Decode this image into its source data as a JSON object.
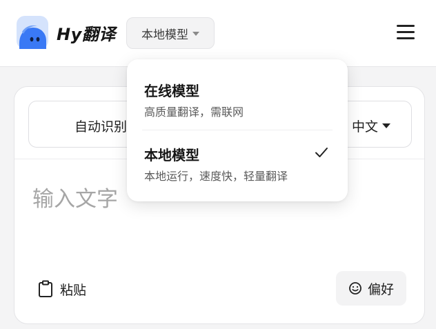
{
  "header": {
    "app_name": "Hy翻译",
    "model_select_label": "本地模型"
  },
  "lang_bar": {
    "source": "自动识别",
    "target": "中文"
  },
  "input": {
    "placeholder": "输入文字"
  },
  "actions": {
    "paste_label": "粘贴",
    "preference_label": "偏好"
  },
  "dropdown": {
    "options": [
      {
        "title": "在线模型",
        "description": "高质量翻译，需联网",
        "selected": false
      },
      {
        "title": "本地模型",
        "description": "本地运行，速度快，轻量翻译",
        "selected": true
      }
    ]
  },
  "colors": {
    "logo_blue": "#3a79f5",
    "logo_light": "#c4d8fb",
    "background": "#f4f4f5"
  },
  "icons": {
    "logo": "hy-cloud-logo-icon",
    "menu": "hamburger-menu-icon",
    "paste": "clipboard-icon",
    "preference": "smiley-icon",
    "selected": "check-icon"
  }
}
